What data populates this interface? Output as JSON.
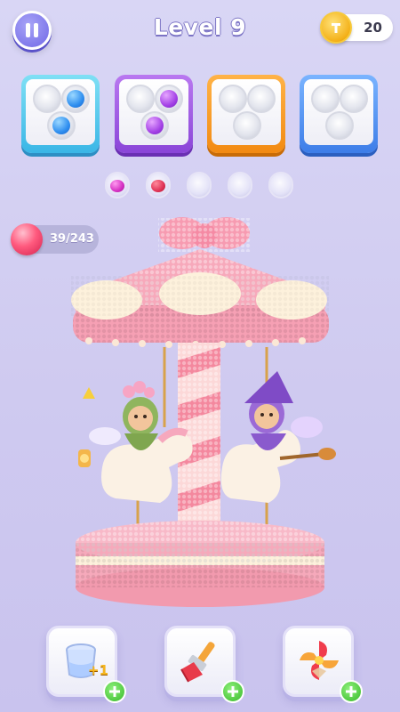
{
  "header": {
    "pause_icon": "pause-icon",
    "level_label": "Level 9",
    "coins": "20",
    "coin_icon": "coin-icon"
  },
  "trays": [
    {
      "color": "#3ab6e6",
      "slots": [
        "empty",
        "blue",
        "blue"
      ]
    },
    {
      "color": "#8a45d8",
      "slots": [
        "empty",
        "purple",
        "purple"
      ]
    },
    {
      "color": "#f28a12",
      "slots": [
        "empty",
        "empty",
        "empty"
      ]
    },
    {
      "color": "#3d7de8",
      "slots": [
        "empty",
        "empty",
        "empty"
      ]
    }
  ],
  "queue": [
    "magenta",
    "red",
    "empty",
    "empty",
    "empty"
  ],
  "progress": {
    "text": "39/243",
    "current": 39,
    "total": 243,
    "icon": "pink-bead-ball-icon"
  },
  "scene": {
    "subject": "carousel-icon",
    "colors": {
      "roof": "#f7a5b8",
      "pole": "#f4889e",
      "base": "#f6b7c6",
      "cloud": "#fdf1dc"
    }
  },
  "boosters": [
    {
      "name": "add-cup-booster",
      "icon": "cup-plus-icon",
      "count_label": "+1",
      "add_icon": "plus-icon"
    },
    {
      "name": "brush-booster",
      "icon": "brush-icon",
      "add_icon": "plus-icon"
    },
    {
      "name": "shuffle-booster",
      "icon": "pinwheel-icon",
      "add_icon": "plus-icon"
    }
  ]
}
